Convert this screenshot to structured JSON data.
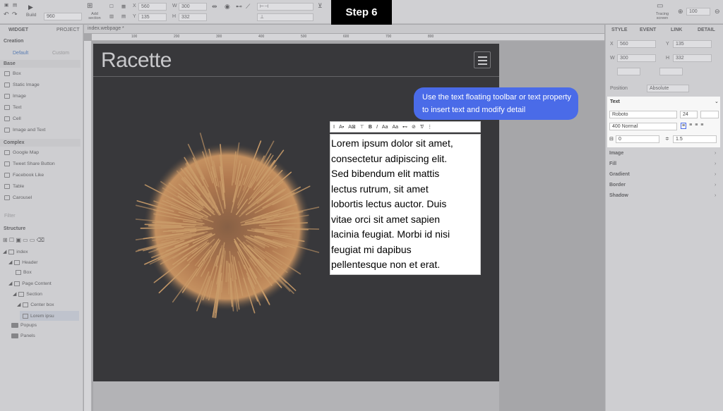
{
  "step_badge": "Step 6",
  "toolbar": {
    "build_label": "Build",
    "zoom_field": "960",
    "add_section_label": "Add section",
    "x_label": "X",
    "x_value": "560",
    "w_label": "W",
    "w_value": "300",
    "y_label": "Y",
    "y_value": "135",
    "h_label": "H",
    "h_value": "332",
    "tracing_label": "Tracing screen",
    "zoom_value": "100"
  },
  "left_panel": {
    "tabs": [
      "WIDGET",
      "PROJECT"
    ],
    "creation_label": "Creation",
    "subtabs": [
      "Default",
      "Custom"
    ],
    "base_header": "Base",
    "base_items": [
      "Box",
      "Static Image",
      "Image",
      "Text",
      "Cell",
      "Image and Text"
    ],
    "complex_header": "Complex",
    "complex_items": [
      "Google Map",
      "Tweet Share Button",
      "Facebook Like",
      "Table",
      "Carousel"
    ],
    "filter_placeholder": "Filter",
    "structure_label": "Structure",
    "tree": [
      "index",
      "Header",
      "Box",
      "Page Content",
      "Section",
      "Center box",
      "Lorem ipsu",
      "Popups",
      "Panels"
    ]
  },
  "doc_tab": "index.webpage *",
  "ruler_marks": [
    "100",
    "200",
    "300",
    "400",
    "500",
    "600",
    "700",
    "800"
  ],
  "page": {
    "logo": "Racette",
    "body_text": "Lorem ipsum dolor sit amet, consectetur adipiscing elit. Sed bibendum elit mattis lectus rutrum, sit amet lobortis lectus auctor. Duis vitae orci sit amet sapien lacinia feugiat. Morbi id nisi feugiat mi dapibus pellentesque non et erat."
  },
  "tooltip": "Use the text floating toolbar or text property to insert text and modify detail",
  "right_panel": {
    "tabs": [
      "STYLE",
      "EVENT",
      "LINK",
      "DETAIL"
    ],
    "x_label": "X",
    "x_value": "560",
    "y_label": "Y",
    "y_value": "135",
    "w_label": "W",
    "w_value": "300",
    "h_label": "H",
    "h_value": "332",
    "position_label": "Position",
    "position_value": "Absolute",
    "text_header": "Text",
    "font_family": "Roboto",
    "font_size": "24",
    "font_weight": "400 Normal",
    "letter_spacing": "0",
    "line_height": "1.5",
    "categories": [
      "Image",
      "Fill",
      "Gradient",
      "Border",
      "Shadow"
    ]
  },
  "colors": {
    "accent": "#4a6be8",
    "page_bg": "#000000",
    "spaghetti": "#c9732a"
  }
}
